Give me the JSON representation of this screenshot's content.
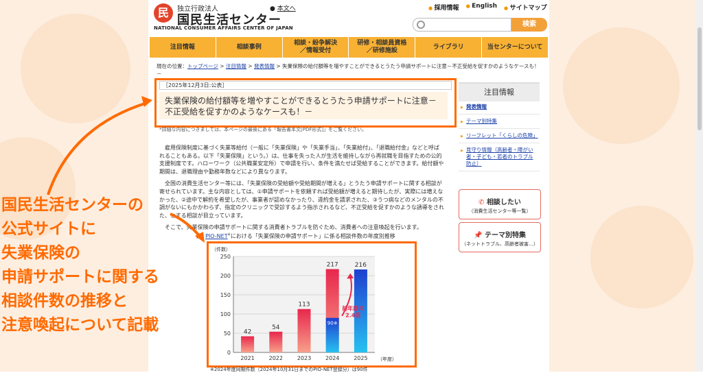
{
  "header": {
    "logo_sub": "独立行政法人",
    "logo_main": "国民生活センター",
    "logo_en": "NATIONAL CONSUMER AFFAIRS CENTER OF JAPAN",
    "skip_link": "本文へ",
    "top_links": [
      "採用情報",
      "English",
      "サイトマップ"
    ],
    "search_button": "検索"
  },
  "nav": [
    "注目情報",
    "相談事例",
    "相談・紛争解決\n／情報受付",
    "研修・相談員資格\n／研修施設",
    "ライブラリ",
    "当センターについて"
  ],
  "breadcrumb": {
    "prefix": "現在の位置：",
    "links": [
      "トップページ",
      "注目情報",
      "発表情報"
    ],
    "current": "失業保険の給付額等を増やすことができるとうたう申請サポートに注意－不正受給を促すかのようなケースも！－"
  },
  "article": {
    "date": "［2025年12月3日:公表］",
    "title": "失業保険の給付額等を増やすことができるとうたう申請サポートに注意－不正受給を促すかのようなケースも！－",
    "note": "*詳細な内容につきましては、本ページの最後にある「報告書本文[PDF形式]」をご覧ください。",
    "para1": "雇用保険制度に基づく失業等給付（一般に「失業保険」や「失業手当」、「失業給付」、「退職給付金」などと呼ばれることもある。以下「失業保険」という。）は、仕事を失った人が生活を維持しながら再就職を目指すための公的支援制度です。ハローワーク（公共職業安定所）で申請を行い、条件を満たせば受給することができます。給付額や期間は、退職理由や勤務年数などにより異なります。",
    "para2": "全国の消費生活センター等には、「失業保険の受給額や受給期間が増える」とうたう申請サポートに関する相談が寄せられています。主な内容としては、①申請サポートを依頼すれば受給額が増えると期待したが、実際には増えなかった、②途中で解約を希望したが、事業者が認めなかったり、違約金を請求された、③うつ病などのメンタルの不調がないにもかかわらず、指定のクリニックで受診するよう指示されるなど、不正受給を促すかのような誘導をされた、とする相談が目立っています。",
    "para3": "そこで、失業保険の申請サポートに関する消費者トラブルを防ぐため、消費者への注意喚起を行います。",
    "fig_prefix": "図.",
    "fig_link": "PIO-NET",
    "fig_rest": "における「失業保険の申請サポート」に係る相談件数の年度別推移",
    "bottom_note": "※2024年度同期件数（2024年10月31日までのPIO-NET登録分）は90件"
  },
  "sidebar": {
    "heading": "注目情報",
    "links": [
      "発表情報",
      "テーマ別特集",
      "リーフレット「くらしの危険」",
      "見守り情報（高齢者・障がい者・子ども・若者のトラブル防止）"
    ],
    "btn1_main": "相談したい",
    "btn1_sub": "（消費生活センター等一覧）",
    "btn2_main": "テーマ別特集",
    "btn2_sub": "（ネットトラブル、高齢者被害…）"
  },
  "overlay_lines": [
    "国民生活センターの",
    "公式サイトに",
    "失業保険の",
    "申請サポートに関する",
    "相談件数の推移と",
    "注意喚起について記載"
  ],
  "colors": {
    "accent": "#ff6a00",
    "nav": "#f8b133",
    "link": "#1a3fa8"
  },
  "chart_data": {
    "type": "bar",
    "ylabel": "（件数）",
    "xlabel": "（年度）",
    "categories": [
      "2021",
      "2022",
      "2023",
      "2024",
      "2025"
    ],
    "values": [
      42,
      54,
      113,
      217,
      216
    ],
    "ylim": [
      0,
      250
    ],
    "yticks": [
      0,
      50,
      100,
      150,
      200,
      250
    ],
    "same_period_2024": 90,
    "same_period_label": "90※",
    "annotation": "前年度の\n2.4倍"
  }
}
